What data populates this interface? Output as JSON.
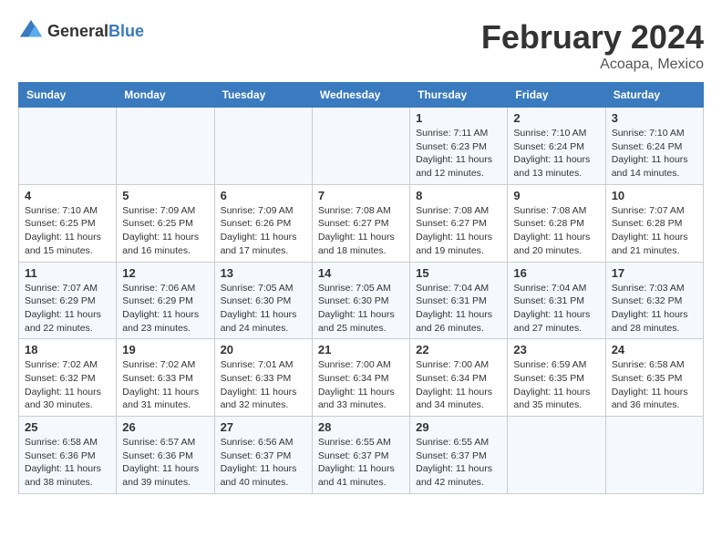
{
  "header": {
    "logo_general": "General",
    "logo_blue": "Blue",
    "title": "February 2024",
    "location": "Acoapa, Mexico"
  },
  "weekdays": [
    "Sunday",
    "Monday",
    "Tuesday",
    "Wednesday",
    "Thursday",
    "Friday",
    "Saturday"
  ],
  "weeks": [
    [
      {
        "day": "",
        "info": ""
      },
      {
        "day": "",
        "info": ""
      },
      {
        "day": "",
        "info": ""
      },
      {
        "day": "",
        "info": ""
      },
      {
        "day": "1",
        "info": "Sunrise: 7:11 AM\nSunset: 6:23 PM\nDaylight: 11 hours\nand 12 minutes."
      },
      {
        "day": "2",
        "info": "Sunrise: 7:10 AM\nSunset: 6:24 PM\nDaylight: 11 hours\nand 13 minutes."
      },
      {
        "day": "3",
        "info": "Sunrise: 7:10 AM\nSunset: 6:24 PM\nDaylight: 11 hours\nand 14 minutes."
      }
    ],
    [
      {
        "day": "4",
        "info": "Sunrise: 7:10 AM\nSunset: 6:25 PM\nDaylight: 11 hours\nand 15 minutes."
      },
      {
        "day": "5",
        "info": "Sunrise: 7:09 AM\nSunset: 6:25 PM\nDaylight: 11 hours\nand 16 minutes."
      },
      {
        "day": "6",
        "info": "Sunrise: 7:09 AM\nSunset: 6:26 PM\nDaylight: 11 hours\nand 17 minutes."
      },
      {
        "day": "7",
        "info": "Sunrise: 7:08 AM\nSunset: 6:27 PM\nDaylight: 11 hours\nand 18 minutes."
      },
      {
        "day": "8",
        "info": "Sunrise: 7:08 AM\nSunset: 6:27 PM\nDaylight: 11 hours\nand 19 minutes."
      },
      {
        "day": "9",
        "info": "Sunrise: 7:08 AM\nSunset: 6:28 PM\nDaylight: 11 hours\nand 20 minutes."
      },
      {
        "day": "10",
        "info": "Sunrise: 7:07 AM\nSunset: 6:28 PM\nDaylight: 11 hours\nand 21 minutes."
      }
    ],
    [
      {
        "day": "11",
        "info": "Sunrise: 7:07 AM\nSunset: 6:29 PM\nDaylight: 11 hours\nand 22 minutes."
      },
      {
        "day": "12",
        "info": "Sunrise: 7:06 AM\nSunset: 6:29 PM\nDaylight: 11 hours\nand 23 minutes."
      },
      {
        "day": "13",
        "info": "Sunrise: 7:05 AM\nSunset: 6:30 PM\nDaylight: 11 hours\nand 24 minutes."
      },
      {
        "day": "14",
        "info": "Sunrise: 7:05 AM\nSunset: 6:30 PM\nDaylight: 11 hours\nand 25 minutes."
      },
      {
        "day": "15",
        "info": "Sunrise: 7:04 AM\nSunset: 6:31 PM\nDaylight: 11 hours\nand 26 minutes."
      },
      {
        "day": "16",
        "info": "Sunrise: 7:04 AM\nSunset: 6:31 PM\nDaylight: 11 hours\nand 27 minutes."
      },
      {
        "day": "17",
        "info": "Sunrise: 7:03 AM\nSunset: 6:32 PM\nDaylight: 11 hours\nand 28 minutes."
      }
    ],
    [
      {
        "day": "18",
        "info": "Sunrise: 7:02 AM\nSunset: 6:32 PM\nDaylight: 11 hours\nand 30 minutes."
      },
      {
        "day": "19",
        "info": "Sunrise: 7:02 AM\nSunset: 6:33 PM\nDaylight: 11 hours\nand 31 minutes."
      },
      {
        "day": "20",
        "info": "Sunrise: 7:01 AM\nSunset: 6:33 PM\nDaylight: 11 hours\nand 32 minutes."
      },
      {
        "day": "21",
        "info": "Sunrise: 7:00 AM\nSunset: 6:34 PM\nDaylight: 11 hours\nand 33 minutes."
      },
      {
        "day": "22",
        "info": "Sunrise: 7:00 AM\nSunset: 6:34 PM\nDaylight: 11 hours\nand 34 minutes."
      },
      {
        "day": "23",
        "info": "Sunrise: 6:59 AM\nSunset: 6:35 PM\nDaylight: 11 hours\nand 35 minutes."
      },
      {
        "day": "24",
        "info": "Sunrise: 6:58 AM\nSunset: 6:35 PM\nDaylight: 11 hours\nand 36 minutes."
      }
    ],
    [
      {
        "day": "25",
        "info": "Sunrise: 6:58 AM\nSunset: 6:36 PM\nDaylight: 11 hours\nand 38 minutes."
      },
      {
        "day": "26",
        "info": "Sunrise: 6:57 AM\nSunset: 6:36 PM\nDaylight: 11 hours\nand 39 minutes."
      },
      {
        "day": "27",
        "info": "Sunrise: 6:56 AM\nSunset: 6:37 PM\nDaylight: 11 hours\nand 40 minutes."
      },
      {
        "day": "28",
        "info": "Sunrise: 6:55 AM\nSunset: 6:37 PM\nDaylight: 11 hours\nand 41 minutes."
      },
      {
        "day": "29",
        "info": "Sunrise: 6:55 AM\nSunset: 6:37 PM\nDaylight: 11 hours\nand 42 minutes."
      },
      {
        "day": "",
        "info": ""
      },
      {
        "day": "",
        "info": ""
      }
    ]
  ]
}
